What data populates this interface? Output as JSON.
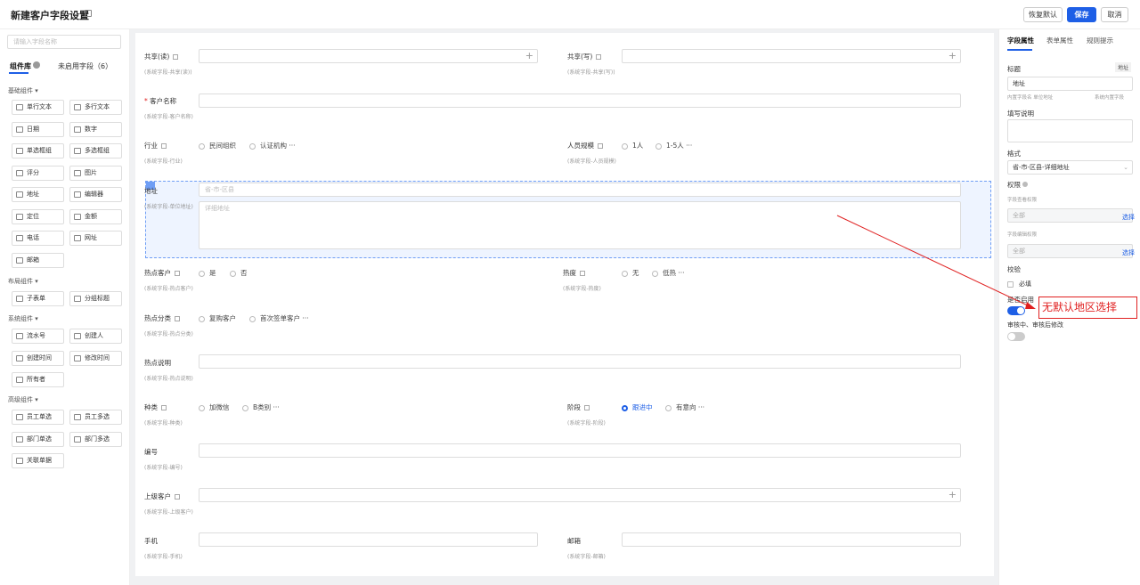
{
  "header": {
    "title": "新建客户字段设置",
    "restore_label": "恢复默认",
    "save_label": "保存",
    "cancel_label": "取消"
  },
  "left": {
    "search_placeholder": "请输入字段名称",
    "tabs": [
      "组件库",
      "未启用字段（6）"
    ],
    "sections": {
      "basic": "基础组件",
      "layout": "布局组件",
      "system": "系统组件",
      "advanced": "高级组件"
    },
    "basic": [
      "单行文本",
      "多行文本",
      "日期",
      "数字",
      "单选框组",
      "多选框组",
      "评分",
      "图片",
      "地址",
      "编辑器",
      "定位",
      "金额",
      "电话",
      "网址",
      "邮箱"
    ],
    "layout": [
      "子表单",
      "分组标题"
    ],
    "system": [
      "流水号",
      "创建人",
      "创建时间",
      "修改时间",
      "所有者"
    ],
    "advanced": [
      "员工单选",
      "员工多选",
      "部门单选",
      "部门多选",
      "关联单据"
    ]
  },
  "form": {
    "share_read": {
      "label": "共享(读)",
      "sub": "(系统字段-共享(读))"
    },
    "share_write": {
      "label": "共享(写)",
      "sub": "(系统字段-共享(写))"
    },
    "customer_name": {
      "required": "*",
      "label": "客户名称",
      "sub": "(系统字段-客户名称)"
    },
    "industry": {
      "label": "行业",
      "sub": "(系统字段-行业)",
      "options": [
        "民间组织",
        "认证机构"
      ],
      "more": "···"
    },
    "staff_size": {
      "label": "人员规模",
      "sub": "(系统字段-人员规模)",
      "options": [
        "1人",
        "1-5人"
      ],
      "more": "···"
    },
    "address": {
      "label": "地址",
      "sub": "(系统字段-单位地址)",
      "placeholder1": "省-市-区县",
      "placeholder2": "详细地址"
    },
    "hot_customer": {
      "label": "热点客户",
      "sub": "(系统字段-热点客户)",
      "options": [
        "是",
        "否"
      ]
    },
    "heat": {
      "label": "热度",
      "sub": "(系统字段-热度)",
      "options": [
        "无",
        "低热"
      ],
      "more": "···"
    },
    "hot_category": {
      "label": "热点分类",
      "sub": "(系统字段-热点分类)",
      "options": [
        "复购客户",
        "首次签单客户"
      ],
      "more": "···"
    },
    "hot_desc": {
      "label": "热点说明",
      "sub": "(系统字段-热点说明)"
    },
    "kind": {
      "label": "种类",
      "sub": "(系统字段-种类)",
      "options": [
        "加微信",
        "B类别"
      ],
      "more": "···"
    },
    "stage": {
      "label": "阶段",
      "sub": "(系统字段-阶段)",
      "options": [
        "跟进中",
        "有意向"
      ],
      "more": "···"
    },
    "number": {
      "label": "编号",
      "sub": "(系统字段-编号)"
    },
    "parent": {
      "label": "上级客户",
      "sub": "(系统字段-上级客户)"
    },
    "mobile": {
      "label": "手机",
      "sub": "(系统字段-手机)"
    },
    "email": {
      "label": "邮箱",
      "sub": "(系统字段-邮箱)"
    }
  },
  "right": {
    "tabs": [
      "字段属性",
      "表单属性",
      "规则提示"
    ],
    "title_label": "标题",
    "title_tag": "地址",
    "title_value": "地址",
    "inner_name": "内置字段名 单位地址",
    "system_field": "系统内置字段",
    "desc_label": "填写说明",
    "format_label": "格式",
    "format_value": "省-市-区县-详细地址",
    "perm_label": "权限",
    "view_perm": "字段查看权限",
    "all1": "全部",
    "choose1": "选择",
    "edit_perm": "字段编辑权限",
    "all2": "全部",
    "choose2": "选择",
    "check_label": "校验",
    "required_label": "必填",
    "enabled_label": "是否启用",
    "review_label": "审核中、审核后修改"
  },
  "annotation": {
    "text": "无默认地区选择",
    "color": "#e02020"
  }
}
